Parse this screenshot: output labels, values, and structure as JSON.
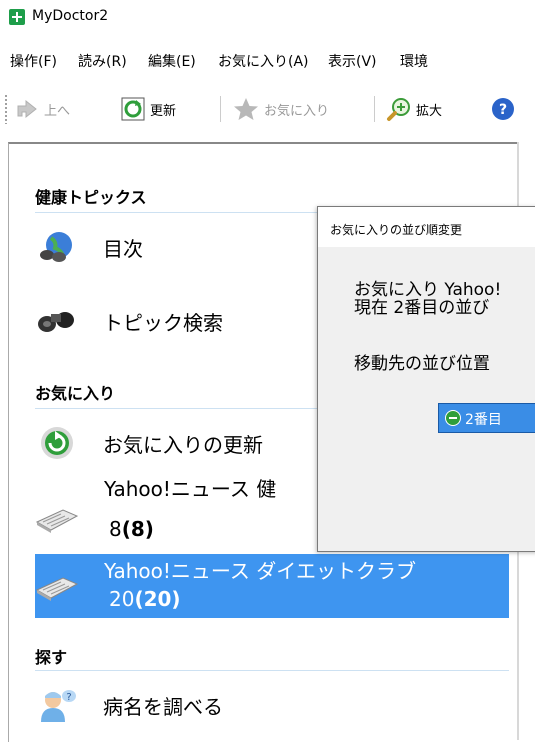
{
  "window": {
    "title": "MyDoctor2"
  },
  "menu": {
    "items": [
      "操作(F)",
      "読み(R)",
      "編集(E)",
      "お気に入り(A)",
      "表示(V)",
      "環境"
    ]
  },
  "toolbar": {
    "up_label": "上へ",
    "refresh_label": "更新",
    "favorites_label": "お気に入り",
    "zoom_label": "拡大"
  },
  "sidebar": {
    "health_topics": {
      "heading": "健康トピックス",
      "items": [
        "目次",
        "トピック検索"
      ]
    },
    "favorites": {
      "heading": "お気に入り",
      "update_label": "お気に入りの更新",
      "entries": [
        {
          "title": "Yahoo!ニュース 健",
          "count": "8",
          "unread": "(8)"
        },
        {
          "title": "Yahoo!ニュース ダイエットクラブ",
          "count": "20",
          "unread": "(20)"
        }
      ]
    },
    "search": {
      "heading": "探す",
      "items": [
        "病名を調べる"
      ]
    }
  },
  "dialog": {
    "title": "お気に入りの並び順変更",
    "line1": "お気に入り Yahoo!",
    "line2": "現在 2番目の並び",
    "line3": "移動先の並び位置",
    "select_value": "2番目"
  },
  "colors": {
    "selection": "#3e95f0",
    "section_line": "#cde1f2",
    "dialog_body": "#f0f0f0"
  }
}
